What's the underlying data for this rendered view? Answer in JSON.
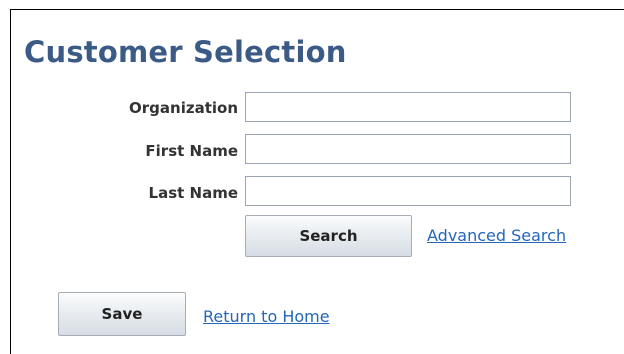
{
  "page": {
    "title": "Customer Selection"
  },
  "form": {
    "fields": [
      {
        "label": "Organization",
        "value": "",
        "placeholder": ""
      },
      {
        "label": "First Name",
        "value": "",
        "placeholder": ""
      },
      {
        "label": "Last Name",
        "value": "",
        "placeholder": ""
      }
    ],
    "search_label": "Search",
    "advanced_search_label": "Advanced Search"
  },
  "footer": {
    "save_label": "Save",
    "return_home_label": "Return to Home"
  },
  "colors": {
    "title": "#3b5a86",
    "link": "#2466b8",
    "label": "#333333"
  }
}
